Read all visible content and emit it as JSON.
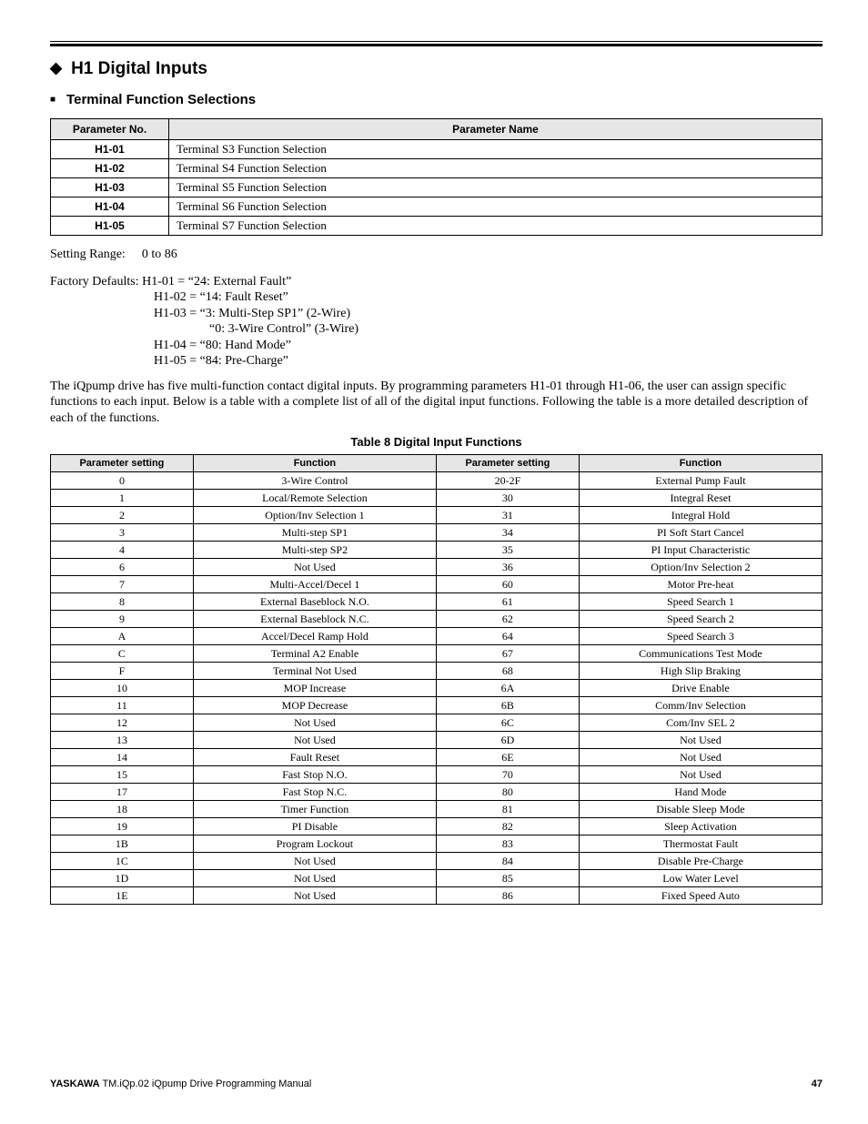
{
  "section": {
    "title": "H1 Digital Inputs",
    "subtitle": "Terminal Function Selections"
  },
  "paramTable": {
    "headers": {
      "no": "Parameter No.",
      "name": "Parameter Name"
    },
    "rows": [
      {
        "no": "H1-01",
        "name": "Terminal S3 Function Selection"
      },
      {
        "no": "H1-02",
        "name": "Terminal S4 Function Selection"
      },
      {
        "no": "H1-03",
        "name": "Terminal S5 Function Selection"
      },
      {
        "no": "H1-04",
        "name": "Terminal S6 Function Selection"
      },
      {
        "no": "H1-05",
        "name": "Terminal S7 Function Selection"
      }
    ]
  },
  "settingRange": {
    "label": "Setting Range:",
    "value": "0 to 86"
  },
  "factoryDefaults": {
    "label": "Factory Defaults:",
    "lines": [
      "H1-01 = “24: External Fault”",
      "H1-02 = “14: Fault Reset”",
      "H1-03 = “3: Multi-Step SP1” (2-Wire)"
    ],
    "subline": "“0: 3-Wire Control” (3-Wire)",
    "lines2": [
      "H1-04 = “80: Hand Mode”",
      "H1-05 = “84: Pre-Charge”"
    ]
  },
  "bodyText": "The iQpump drive has five multi-function contact digital inputs. By programming parameters H1-01 through H1-06, the user can assign specific functions to each input. Below is a table with a complete list of all of the digital input functions. Following the table is a more detailed description of each of the functions.",
  "tableCaption": "Table 8   Digital Input Functions",
  "chart_data": {
    "type": "table",
    "title": "Digital Input Functions",
    "columns": [
      "Parameter setting",
      "Function",
      "Parameter setting",
      "Function"
    ],
    "rows": [
      [
        "0",
        "3-Wire Control",
        "20-2F",
        "External Pump Fault"
      ],
      [
        "1",
        "Local/Remote Selection",
        "30",
        "Integral Reset"
      ],
      [
        "2",
        "Option/Inv Selection 1",
        "31",
        "Integral Hold"
      ],
      [
        "3",
        "Multi-step SP1",
        "34",
        "PI Soft Start Cancel"
      ],
      [
        "4",
        "Multi-step SP2",
        "35",
        "PI Input Characteristic"
      ],
      [
        "6",
        "Not Used",
        "36",
        "Option/Inv Selection 2"
      ],
      [
        "7",
        "Multi-Accel/Decel 1",
        "60",
        "Motor Pre-heat"
      ],
      [
        "8",
        "External Baseblock N.O.",
        "61",
        "Speed Search 1"
      ],
      [
        "9",
        "External Baseblock N.C.",
        "62",
        "Speed Search 2"
      ],
      [
        "A",
        "Accel/Decel Ramp Hold",
        "64",
        "Speed Search 3"
      ],
      [
        "C",
        "Terminal A2 Enable",
        "67",
        "Communications Test Mode"
      ],
      [
        "F",
        "Terminal Not Used",
        "68",
        "High Slip Braking"
      ],
      [
        "10",
        "MOP Increase",
        "6A",
        "Drive Enable"
      ],
      [
        "11",
        "MOP Decrease",
        "6B",
        "Comm/Inv Selection"
      ],
      [
        "12",
        "Not Used",
        "6C",
        "Com/Inv SEL 2"
      ],
      [
        "13",
        "Not Used",
        "6D",
        "Not Used"
      ],
      [
        "14",
        "Fault Reset",
        "6E",
        "Not Used"
      ],
      [
        "15",
        "Fast Stop N.O.",
        "70",
        "Not Used"
      ],
      [
        "17",
        "Fast Stop N.C.",
        "80",
        "Hand Mode"
      ],
      [
        "18",
        "Timer Function",
        "81",
        "Disable Sleep Mode"
      ],
      [
        "19",
        "PI Disable",
        "82",
        "Sleep Activation"
      ],
      [
        "1B",
        "Program Lockout",
        "83",
        "Thermostat Fault"
      ],
      [
        "1C",
        "Not Used",
        "84",
        "Disable Pre-Charge"
      ],
      [
        "1D",
        "Not Used",
        "85",
        "Low Water Level"
      ],
      [
        "1E",
        "Not Used",
        "86",
        "Fixed Speed Auto"
      ]
    ]
  },
  "footer": {
    "brand": "YASKAWA",
    "doc": " TM.iQp.02 iQpump Drive Programming Manual",
    "page": "47"
  }
}
